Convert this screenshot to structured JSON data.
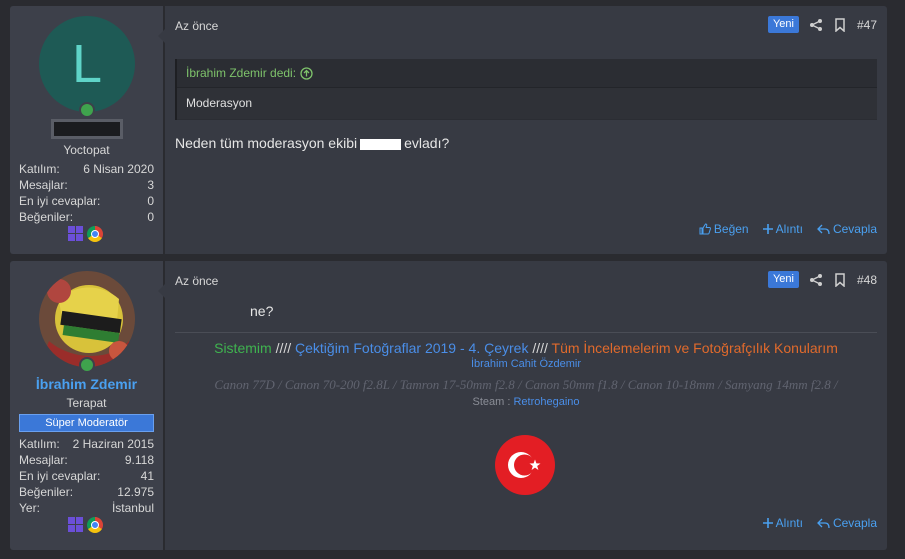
{
  "posts": [
    {
      "user": {
        "avatar_letter": "L",
        "title": "Yoctopat",
        "stats": [
          {
            "label": "Katılım:",
            "value": "6 Nisan 2020"
          },
          {
            "label": "Mesajlar:",
            "value": "3"
          },
          {
            "label": "En iyi cevaplar:",
            "value": "0"
          },
          {
            "label": "Beğeniler:",
            "value": "0"
          }
        ]
      },
      "time": "Az önce",
      "new_badge": "Yeni",
      "number": "#47",
      "quote": {
        "author": "İbrahim Zdemir dedi:",
        "text": "Moderasyon"
      },
      "text_before": "Neden tüm moderasyon ekibi",
      "text_after": "evladı?",
      "actions": {
        "like": "Beğen",
        "quote": "Alıntı",
        "reply": "Cevapla"
      }
    },
    {
      "user": {
        "name": "İbrahim Zdemir",
        "title": "Terapat",
        "banner": "Süper Moderatör",
        "stats": [
          {
            "label": "Katılım:",
            "value": "2 Haziran 2015"
          },
          {
            "label": "Mesajlar:",
            "value": "9.118"
          },
          {
            "label": "En iyi cevaplar:",
            "value": "41"
          },
          {
            "label": "Beğeniler:",
            "value": "12.975"
          },
          {
            "label": "Yer:",
            "value": "İstanbul"
          }
        ]
      },
      "time": "Az önce",
      "new_badge": "Yeni",
      "number": "#48",
      "text": "ne?",
      "signature": {
        "part1": "Sistemim",
        "sep": "////",
        "part2": "Çektiğim Fotoğraflar 2019 - 4. Çeyrek",
        "part3": "Tüm İncelemelerim ve Fotoğrafçılık Konularım",
        "name": "İbrahim Cahit Özdemir",
        "gear": "Canon 77D / Canon 70-200 f2.8L / Tamron 17-50mm f2.8 / Canon 50mm f1.8 / Canon 10-18mm / Samyang 14mm f2.8 /",
        "steam_label": "Steam :",
        "steam_user": "Retrohegaino"
      },
      "actions": {
        "quote": "Alıntı",
        "reply": "Cevapla"
      }
    }
  ],
  "colors": {
    "accent": "#4aa0f0",
    "badge": "#3b78d8",
    "online": "#3fa34d"
  }
}
